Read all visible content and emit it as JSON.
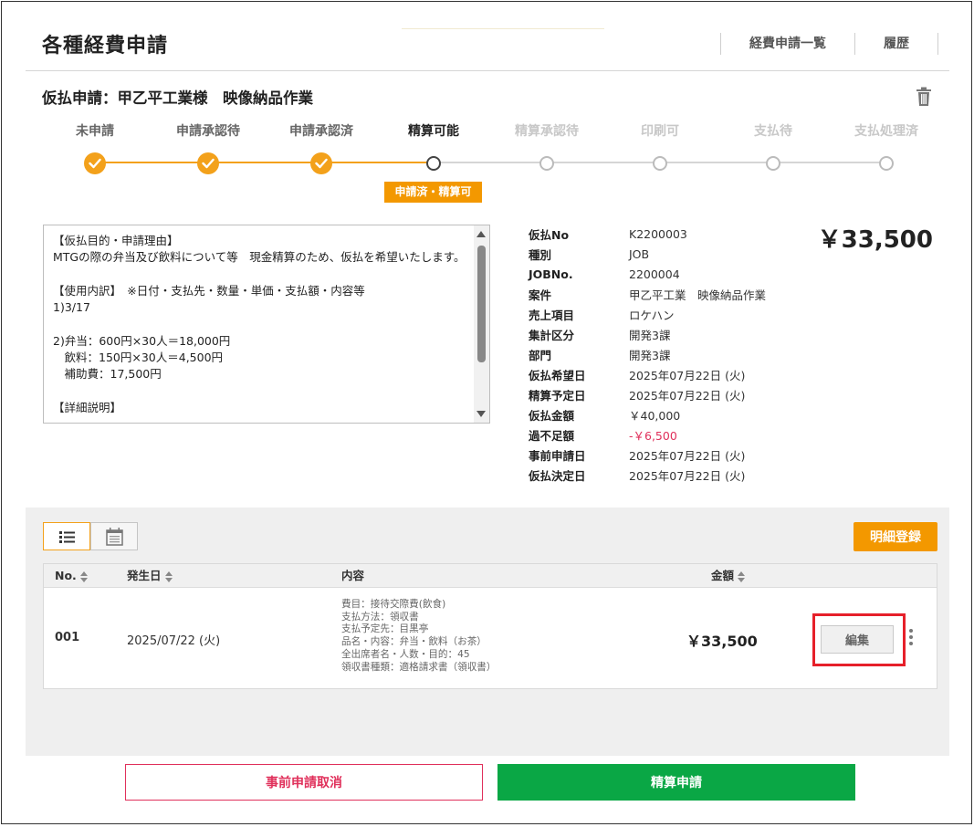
{
  "header": {
    "title": "各種経費申請",
    "nav": [
      "経費申請一覧",
      "履歴"
    ]
  },
  "request": {
    "title": "仮払申請：甲乙平工業様　映像納品作業"
  },
  "stepper": {
    "steps": [
      {
        "label": "未申請",
        "state": "done"
      },
      {
        "label": "申請承認待",
        "state": "done"
      },
      {
        "label": "申請承認済",
        "state": "done"
      },
      {
        "label": "精算可能",
        "state": "current"
      },
      {
        "label": "精算承認待",
        "state": "todo"
      },
      {
        "label": "印刷可",
        "state": "todo"
      },
      {
        "label": "支払待",
        "state": "todo"
      },
      {
        "label": "支払処理済",
        "state": "todo"
      }
    ],
    "status_badge": "申請済・精算可"
  },
  "purpose": {
    "text": "【仮払目的・申請理由】\nMTGの際の弁当及び飲料について等　現金精算のため、仮払を希望いたします。\n\n【使用内訳】　※日付・支払先・数量・単価・支払額・内容等\n1)3/17\n\n2)弁当：600円×30人＝18,000円\n　飲料：150円×30人＝4,500円\n　補助費：17,500円\n\n【詳細説明】"
  },
  "details": [
    {
      "key": "仮払No",
      "value": "K2200003"
    },
    {
      "key": "種別",
      "value": "JOB"
    },
    {
      "key": "JOBNo.",
      "value": "2200004"
    },
    {
      "key": "案件",
      "value": "甲乙平工業　映像納品作業"
    },
    {
      "key": "売上項目",
      "value": "ロケハン"
    },
    {
      "key": "集計区分",
      "value": "開発3課"
    },
    {
      "key": "部門",
      "value": "開発3課"
    },
    {
      "key": "仮払希望日",
      "value": "2025年07月22日 (火)"
    },
    {
      "key": "精算予定日",
      "value": "2025年07月22日 (火)"
    },
    {
      "key": "仮払金額",
      "value": "￥40,000"
    },
    {
      "key": "過不足額",
      "value": "-￥6,500"
    },
    {
      "key": "事前申請日",
      "value": "2025年07月22日 (火)"
    },
    {
      "key": "仮払決定日",
      "value": "2025年07月22日 (火)"
    }
  ],
  "total": "￥33,500",
  "list": {
    "register_label": "明細登録",
    "columns": {
      "no": "No.",
      "date": "発生日",
      "content": "内容",
      "amount": "金額"
    },
    "rows": [
      {
        "no": "001",
        "date": "2025/07/22 (火)",
        "content": [
          "費目：接待交際費(飲食)",
          "支払方法：領収書",
          "支払予定先：目黒亭",
          "品名・内容：弁当・飲料（お茶）",
          "全出席者名・人数・目的：45",
          "領収書種類：適格請求書（領収書）"
        ],
        "amount": "￥33,500",
        "edit_label": "編集"
      }
    ]
  },
  "footer": {
    "cancel_label": "事前申請取消",
    "submit_label": "精算申請"
  },
  "colors": {
    "accent": "#f39800",
    "danger": "#e0305b",
    "success": "#0aa745",
    "highlight": "#e6202a"
  }
}
